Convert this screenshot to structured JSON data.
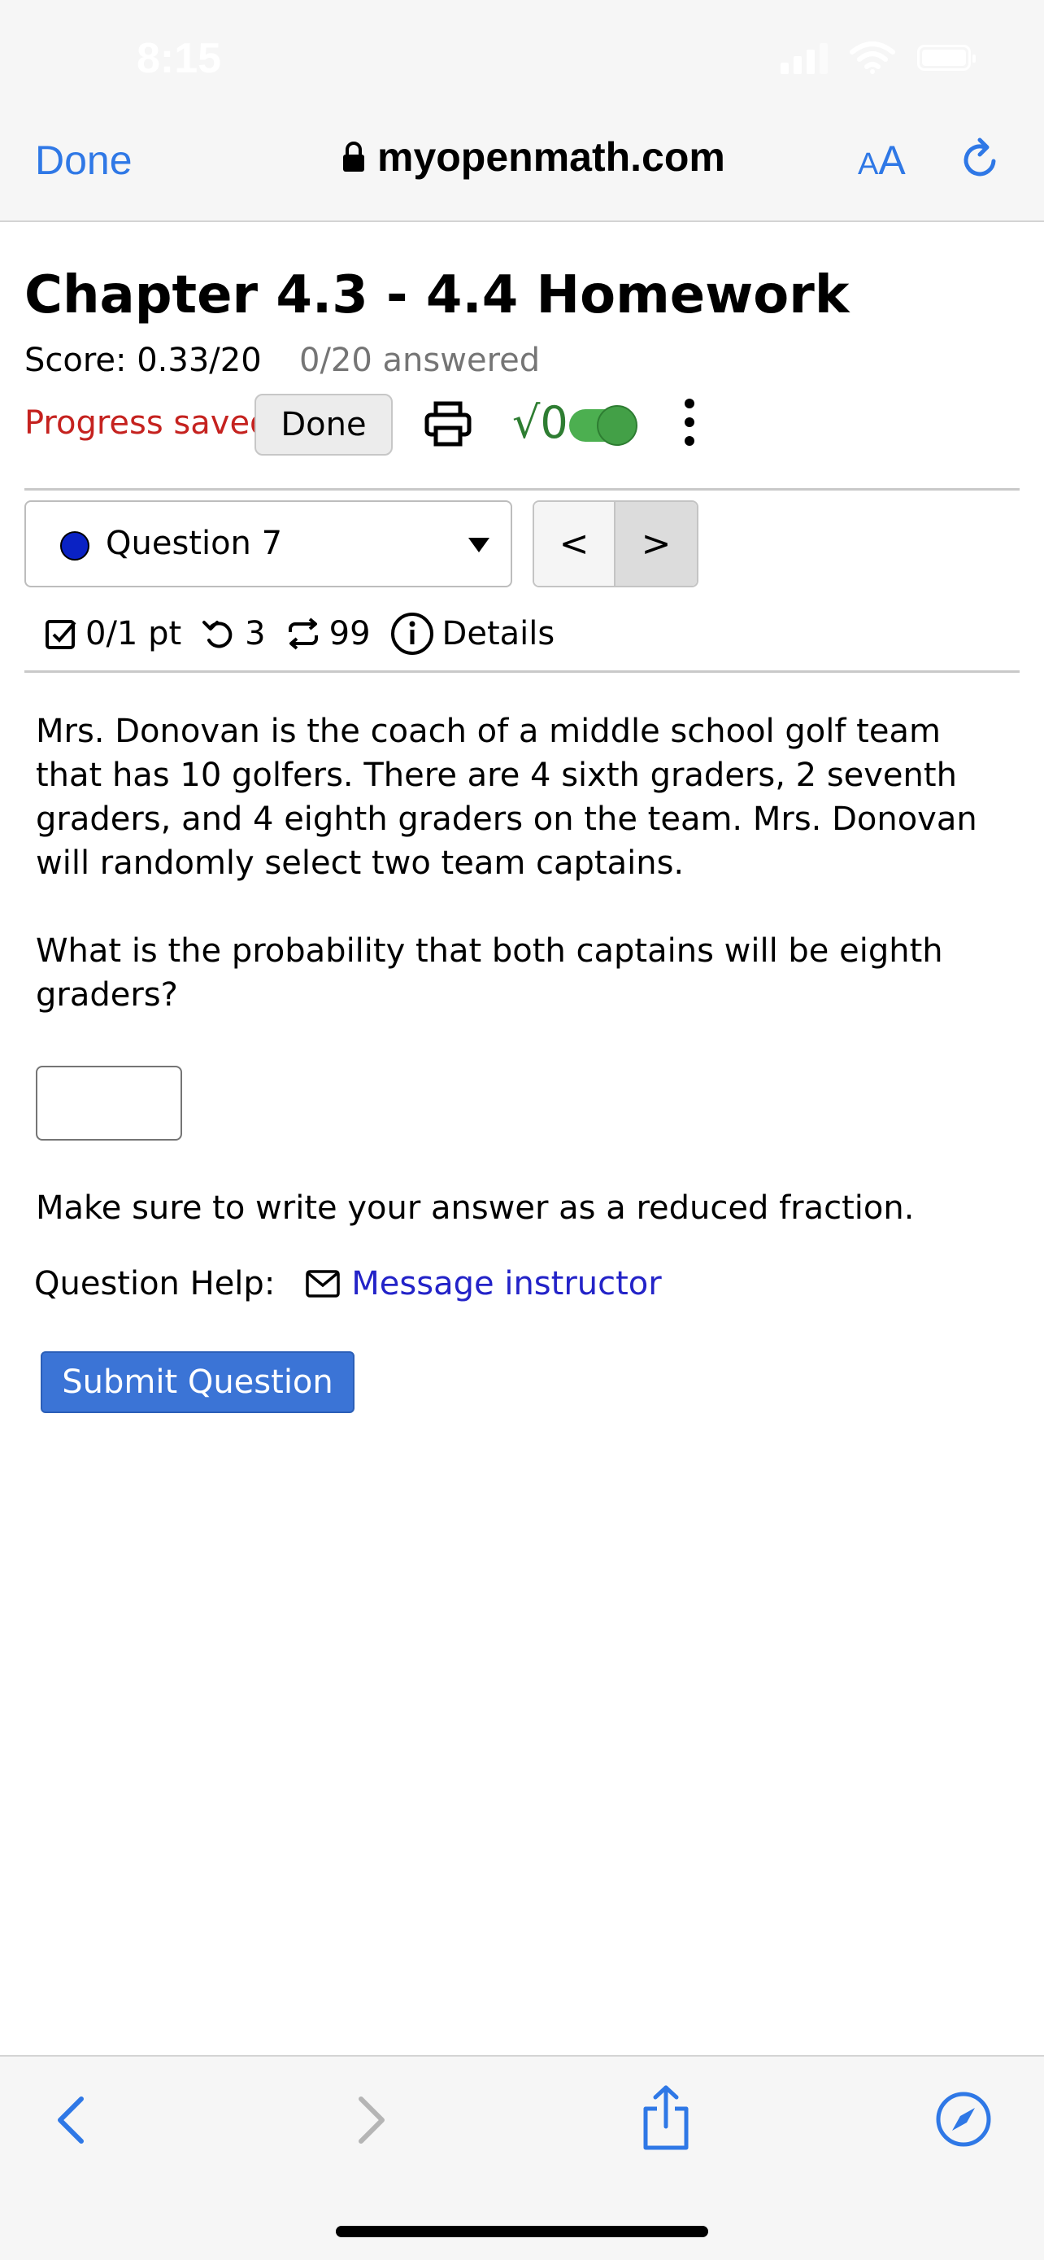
{
  "status_bar": {
    "time": "8:15"
  },
  "browser": {
    "done_label": "Done",
    "url": "myopenmath.com",
    "text_size_label_small": "A",
    "text_size_label_big": "A"
  },
  "page": {
    "title": "Chapter 4.3 - 4.4 Homework",
    "score": "Score: 0.33/20",
    "answered": "0/20 answered",
    "progress_saved": "Progress saved",
    "done_button": "Done",
    "sqrt_label": "√0"
  },
  "question_nav": {
    "selected": "Question 7",
    "prev_label": "<",
    "next_label": ">"
  },
  "meta": {
    "points": "0/1 pt",
    "retries": "3",
    "attempts": "99",
    "details": "Details"
  },
  "question": {
    "paragraph1": "Mrs. Donovan is the coach of a middle school golf team that has 10 golfers. There are 4 sixth graders, 2 seventh graders, and 4 eighth graders on the team. Mrs. Donovan will randomly select two team captains.",
    "paragraph2": "What is the probability that both captains will be eighth graders?",
    "answer_value": "",
    "note": "Make sure to write your answer as a reduced fraction.",
    "help_label": "Question Help:",
    "help_link": "Message instructor",
    "submit": "Submit Question"
  },
  "colors": {
    "accent": "#2f78e6",
    "progress_saved": "#c5221f",
    "submit": "#3b74d6",
    "link": "#2323c8",
    "toggle": "#43a047"
  },
  "icons": {
    "lock": "lock-icon",
    "reload": "reload-icon",
    "print": "printer-icon",
    "more": "more-vertical-icon",
    "mail": "mail-icon",
    "info": "info-icon",
    "check": "checkbox-icon",
    "retry": "retry-icon",
    "attempts": "repeat-icon",
    "back": "back-chevron-icon",
    "forward": "forward-chevron-icon",
    "share": "share-icon",
    "compass": "compass-icon"
  }
}
